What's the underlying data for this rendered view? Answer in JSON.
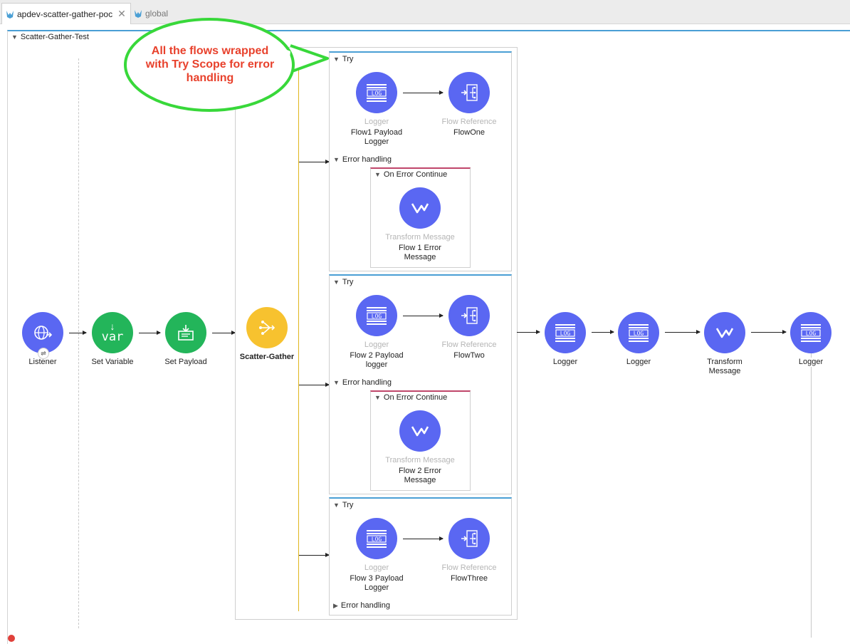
{
  "tabs": [
    {
      "label": "apdev-scatter-gather-poc",
      "active": true
    },
    {
      "label": "global",
      "active": false
    }
  ],
  "flow": {
    "title": "Scatter-Gather-Test"
  },
  "callout": {
    "text": "All the flows wrapped with Try Scope for error handling"
  },
  "main_nodes": {
    "listener": {
      "label": "Listener"
    },
    "set_variable": {
      "label": "Set Variable",
      "icon_text": "var"
    },
    "set_payload": {
      "label": "Set Payload"
    },
    "scatter_gather": {
      "label": "Scatter-Gather"
    },
    "logger1": {
      "label": "Logger"
    },
    "logger2": {
      "label": "Logger"
    },
    "transform": {
      "label": "Transform Message"
    },
    "logger3": {
      "label": "Logger"
    }
  },
  "routes": [
    {
      "try_label": "Try",
      "logger_type": "Logger",
      "logger_name": "Flow1 Payload Logger",
      "ref_type": "Flow Reference",
      "ref_name": "FlowOne",
      "error_label": "Error handling",
      "on_error": "On Error Continue",
      "transform_type": "Transform Message",
      "transform_name": "Flow 1 Error Message"
    },
    {
      "try_label": "Try",
      "logger_type": "Logger",
      "logger_name": "Flow 2 Payload logger",
      "ref_type": "Flow Reference",
      "ref_name": "FlowTwo",
      "error_label": "Error handling",
      "on_error": "On Error Continue",
      "transform_type": "Transform Message",
      "transform_name": "Flow 2 Error Message"
    },
    {
      "try_label": "Try",
      "logger_type": "Logger",
      "logger_name": "Flow 3 Payload Logger",
      "ref_type": "Flow Reference",
      "ref_name": "FlowThree",
      "error_label": "Error handling"
    }
  ],
  "icons": {
    "logger": "LOG",
    "colors": {
      "purple": "#5a67f2",
      "green": "#23b55a",
      "yellow": "#f7c22f",
      "accent": "#4a9fd5",
      "error": "#c0466a",
      "callout": "#e8412c"
    }
  }
}
